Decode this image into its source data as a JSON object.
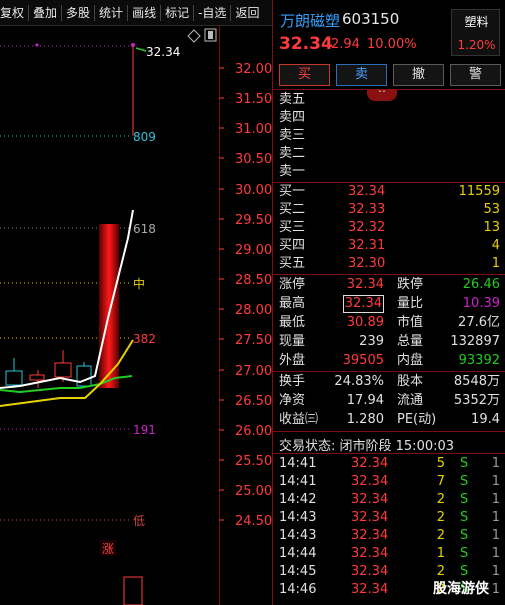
{
  "toolbar": {
    "items": [
      "复权",
      "叠加",
      "多股",
      "统计",
      "画线",
      "标记",
      "-自选",
      "返回"
    ]
  },
  "chart": {
    "diamond_icon": "diamond-icon",
    "square_icon": "square-icon",
    "price_axis": [
      "32.00",
      "31.50",
      "31.00",
      "30.50",
      "30.00",
      "29.50",
      "29.00",
      "28.50",
      "28.00",
      "27.50",
      "27.00",
      "26.50",
      "26.00",
      "25.50",
      "25.00",
      "24.50"
    ],
    "high_label": "32.34",
    "levels": {
      "l809": "809",
      "l618": "618",
      "mid": "中",
      "l382": "382",
      "l191": "191",
      "low": "低"
    },
    "limit_up_tag": "涨",
    "colors": {
      "axis": "#ff3b3b",
      "cyan": "#2bc4d8",
      "magenta": "#d020d0",
      "yellow": "#e8d000",
      "green": "#22cc22",
      "white": "#ffffff",
      "grid": "#4a1010"
    }
  },
  "quote": {
    "name": "万朗磁塑",
    "code": "603150",
    "price": "32.34",
    "change": "2.94",
    "change_pct": "10.00%",
    "sector": {
      "name": "塑料",
      "pct": "1.20%"
    }
  },
  "buttons": {
    "buy": "买",
    "sell": "卖",
    "cancel": "撤",
    "alert": "警"
  },
  "order_book": {
    "asks": [
      {
        "label": "卖五",
        "price": "",
        "vol": ""
      },
      {
        "label": "卖四",
        "price": "",
        "vol": ""
      },
      {
        "label": "卖三",
        "price": "",
        "vol": ""
      },
      {
        "label": "卖二",
        "price": "",
        "vol": ""
      },
      {
        "label": "卖一",
        "price": "",
        "vol": ""
      }
    ],
    "bids": [
      {
        "label": "买一",
        "price": "32.34",
        "vol": "11559"
      },
      {
        "label": "买二",
        "price": "32.33",
        "vol": "53"
      },
      {
        "label": "买三",
        "price": "32.32",
        "vol": "13"
      },
      {
        "label": "买四",
        "price": "32.31",
        "vol": "4"
      },
      {
        "label": "买五",
        "price": "32.30",
        "vol": "1"
      }
    ]
  },
  "stats": {
    "limit_up_label": "涨停",
    "limit_up": "32.34",
    "limit_down_label": "跌停",
    "limit_down": "26.46",
    "high_label": "最高",
    "high": "32.34",
    "vol_ratio_label": "量比",
    "vol_ratio": "10.39",
    "low_label": "最低",
    "low": "30.89",
    "mkt_cap_label": "市值",
    "mkt_cap": "27.6亿",
    "cur_vol_label": "现量",
    "cur_vol": "239",
    "total_vol_label": "总量",
    "total_vol": "132897",
    "outer_label": "外盘",
    "outer": "39505",
    "inner_label": "内盘",
    "inner": "93392",
    "turnover_label": "换手",
    "turnover": "24.83%",
    "shares_label": "股本",
    "shares": "8548万",
    "nav_label": "净资",
    "nav": "17.94",
    "float_label": "流通",
    "float": "5352万",
    "eps_label": "收益㈢",
    "eps": "1.280",
    "pe_label": "PE(动)",
    "pe": "19.4"
  },
  "trade_status": "交易状态: 闭市阶段 15:00:03",
  "ticks": [
    {
      "time": "14:41",
      "price": "32.34",
      "vol": "5",
      "side": "S",
      "cnt": "1"
    },
    {
      "time": "14:41",
      "price": "32.34",
      "vol": "7",
      "side": "S",
      "cnt": "1"
    },
    {
      "time": "14:42",
      "price": "32.34",
      "vol": "2",
      "side": "S",
      "cnt": "1"
    },
    {
      "time": "14:43",
      "price": "32.34",
      "vol": "2",
      "side": "S",
      "cnt": "1"
    },
    {
      "time": "14:43",
      "price": "32.34",
      "vol": "2",
      "side": "S",
      "cnt": "1"
    },
    {
      "time": "14:44",
      "price": "32.34",
      "vol": "1",
      "side": "S",
      "cnt": "1"
    },
    {
      "time": "14:45",
      "price": "32.34",
      "vol": "2",
      "side": "S",
      "cnt": "1"
    },
    {
      "time": "14:46",
      "price": "32.34",
      "vol": "2",
      "side": "S",
      "cnt": "1"
    }
  ],
  "watermark": "股海游侠"
}
